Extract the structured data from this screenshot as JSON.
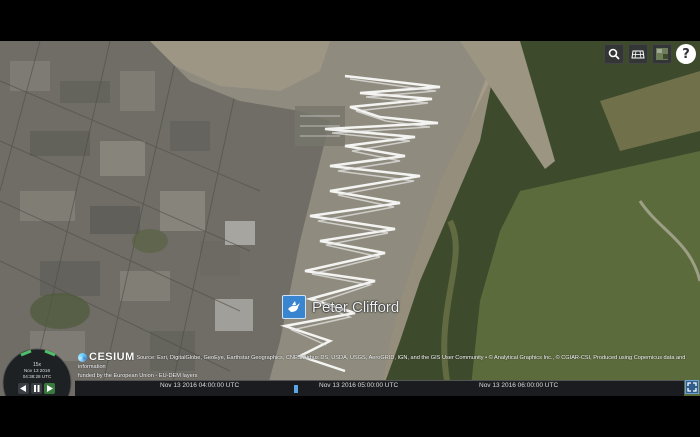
{
  "label": {
    "text": "Peter Clifford"
  },
  "toolbar": {
    "search_icon": "search-icon",
    "imagery_icon": "globe-grid-icon",
    "layer_icon": "base-layer-picker-icon",
    "help_label": "?"
  },
  "credits": {
    "logo_text": "CESIUM",
    "line1": "Source: Esri, DigitalGlobe, GeoEye, Earthstar Geographics, CNES/Airbus DS, USDA, USGS, AeroGRID, IGN, and the GIS User Community • © Analytical Graphics Inc., © CGIAR-CSI, Produced using Copernicus data and information",
    "line2": "funded by the European Union - EU-DEM layers"
  },
  "animation": {
    "speed": "15x",
    "date": "Nov 13 2016",
    "time": "04:38:28 UTC"
  },
  "timeline": {
    "ticks": [
      "Nov 13 2016 04:00:00 UTC",
      "Nov 13 2016 05:00:00 UTC",
      "Nov 13 2016 06:00:00 UTC"
    ]
  },
  "colors": {
    "water": "#8f8c7f",
    "track": "#ffffff",
    "mangrove": "#3d4a2c",
    "city": "#7d7b74",
    "accent": "#3a85d0"
  }
}
